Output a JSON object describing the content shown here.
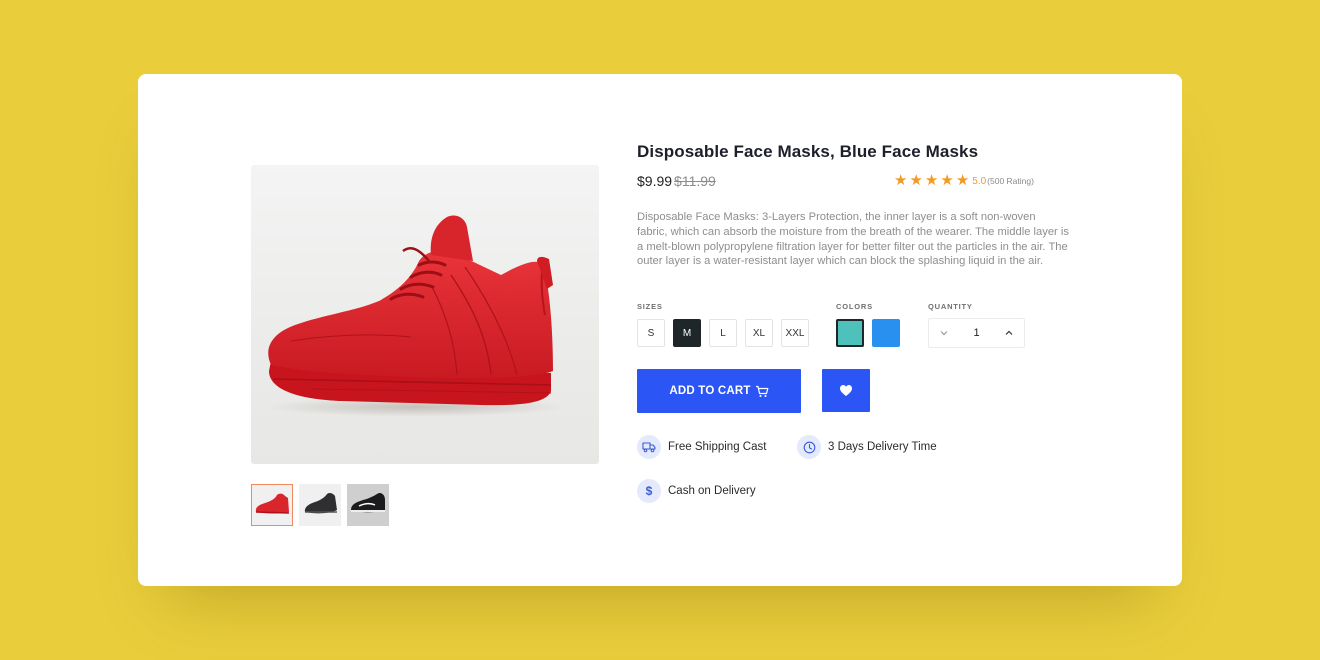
{
  "product": {
    "title": "Disposable Face Masks, Blue Face Masks",
    "price": "$9.99",
    "old_price": "$11.99",
    "rating_score": "5.0",
    "rating_count": "(500 Rating)",
    "stars": 5,
    "description": "Disposable Face Masks: 3-Layers Protection, the inner layer is a soft non-woven fabric, which can absorb the moisture from the breath of the wearer. The middle layer is a melt-blown polypropylene filtration layer for better filter out the particles in the air. The outer layer is a water-resistant layer which can block the splashing liquid in the air."
  },
  "gallery": {
    "thumbnails": [
      {
        "name": "red-sneaker-thumbnail",
        "active": true
      },
      {
        "name": "black-sneaker-thumbnail",
        "active": false
      },
      {
        "name": "black-white-sneaker-thumbnail",
        "active": false
      }
    ]
  },
  "sizes": {
    "label": "SIZES",
    "options": [
      "S",
      "M",
      "L",
      "XL",
      "XXL"
    ],
    "selected": "M"
  },
  "colors": {
    "label": "COLORS",
    "options": [
      "#4fc1bb",
      "#2990f0"
    ],
    "selected": "#4fc1bb"
  },
  "quantity": {
    "label": "QUANTITY",
    "value": "1"
  },
  "actions": {
    "add_to_cart": "ADD TO CART",
    "wishlist_icon": "heart-icon",
    "cart_icon": "cart-icon"
  },
  "features": [
    {
      "icon": "truck-icon",
      "text": "Free Shipping Cast"
    },
    {
      "icon": "clock-icon",
      "text": "3 Days Delivery Time"
    },
    {
      "icon": "dollar-icon",
      "text": "Cash on Delivery"
    }
  ],
  "theme": {
    "background": "#e9cd3b",
    "accent": "#2c55f5",
    "star": "#f39a26"
  }
}
